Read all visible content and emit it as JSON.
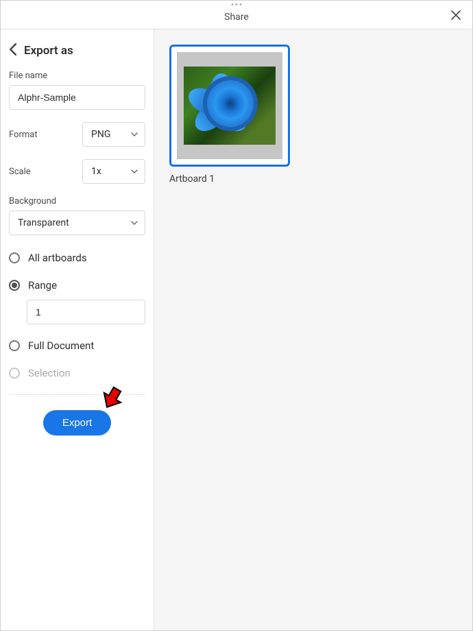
{
  "header": {
    "title": "Share"
  },
  "sidebar": {
    "panel_title": "Export as",
    "file_name_label": "File name",
    "file_name_value": "Alphr-Sample",
    "format_label": "Format",
    "format_value": "PNG",
    "scale_label": "Scale",
    "scale_value": "1x",
    "background_label": "Background",
    "background_value": "Transparent",
    "radio": {
      "all_artboards": "All artboards",
      "range": "Range",
      "range_value": "1",
      "full_document": "Full Document",
      "selection": "Selection"
    },
    "export_button": "Export"
  },
  "main": {
    "artboard_title": "Artboard 1"
  }
}
